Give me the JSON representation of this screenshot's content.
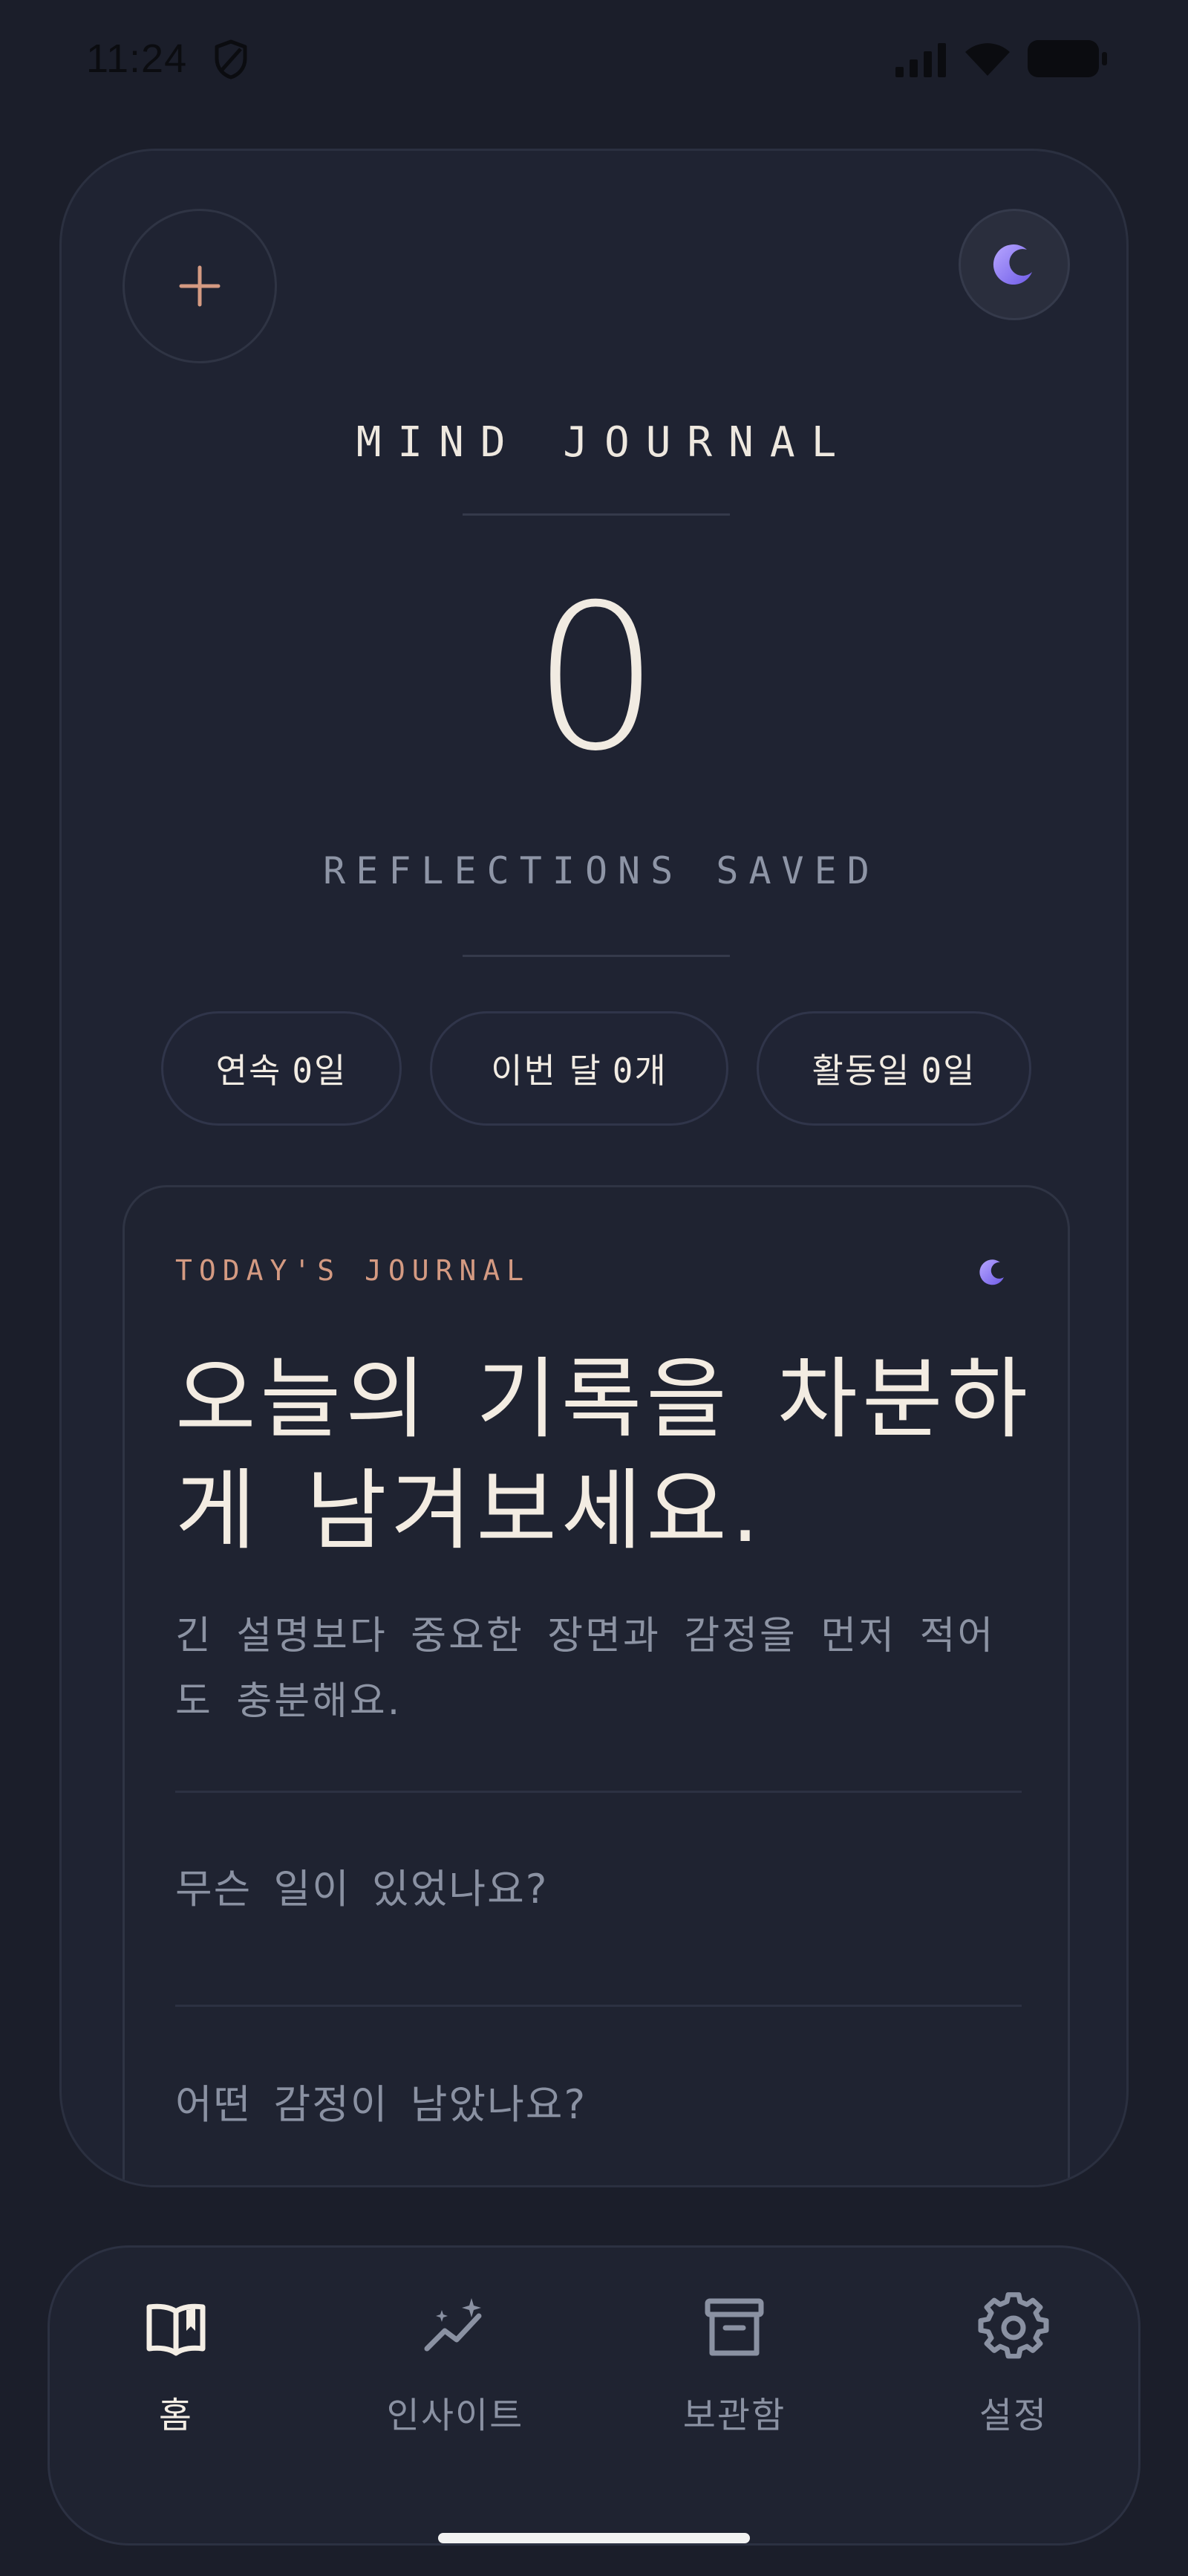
{
  "status_bar": {
    "time": "11:24"
  },
  "header": {
    "app_title": "MIND JOURNAL",
    "reflection_count": "0",
    "reflection_label": "REFLECTIONS SAVED"
  },
  "stats": [
    {
      "label": "연속",
      "value": "0일"
    },
    {
      "label": "이번 달",
      "value": "0개"
    },
    {
      "label": "활동일",
      "value": "0일"
    }
  ],
  "journal": {
    "kicker": "TODAY'S JOURNAL",
    "headline_line1": "오늘의 기록을 차분하",
    "headline_line2": "게 남겨보세요.",
    "desc_line1": "긴 설명보다 중요한 장면과 감정을 먼저 적어",
    "desc_line2": "도 충분해요.",
    "prompt_event": "무슨 일이 있었나요?",
    "prompt_emotion": "어떤 감정이 남았나요?"
  },
  "nav": {
    "items": [
      {
        "label": "홈",
        "icon": "book-open-icon",
        "active": true
      },
      {
        "label": "인사이트",
        "icon": "sparkle-chart-icon",
        "active": false
      },
      {
        "label": "보관함",
        "icon": "archive-box-icon",
        "active": false
      },
      {
        "label": "설정",
        "icon": "gear-icon",
        "active": false
      }
    ]
  },
  "colors": {
    "background": "#1b1e2a",
    "card": "#1f2332",
    "accent_coral": "#d49a82",
    "accent_violet": "#8b7bf0",
    "text_primary": "#f1ebe2",
    "text_muted": "#8c93a3"
  }
}
